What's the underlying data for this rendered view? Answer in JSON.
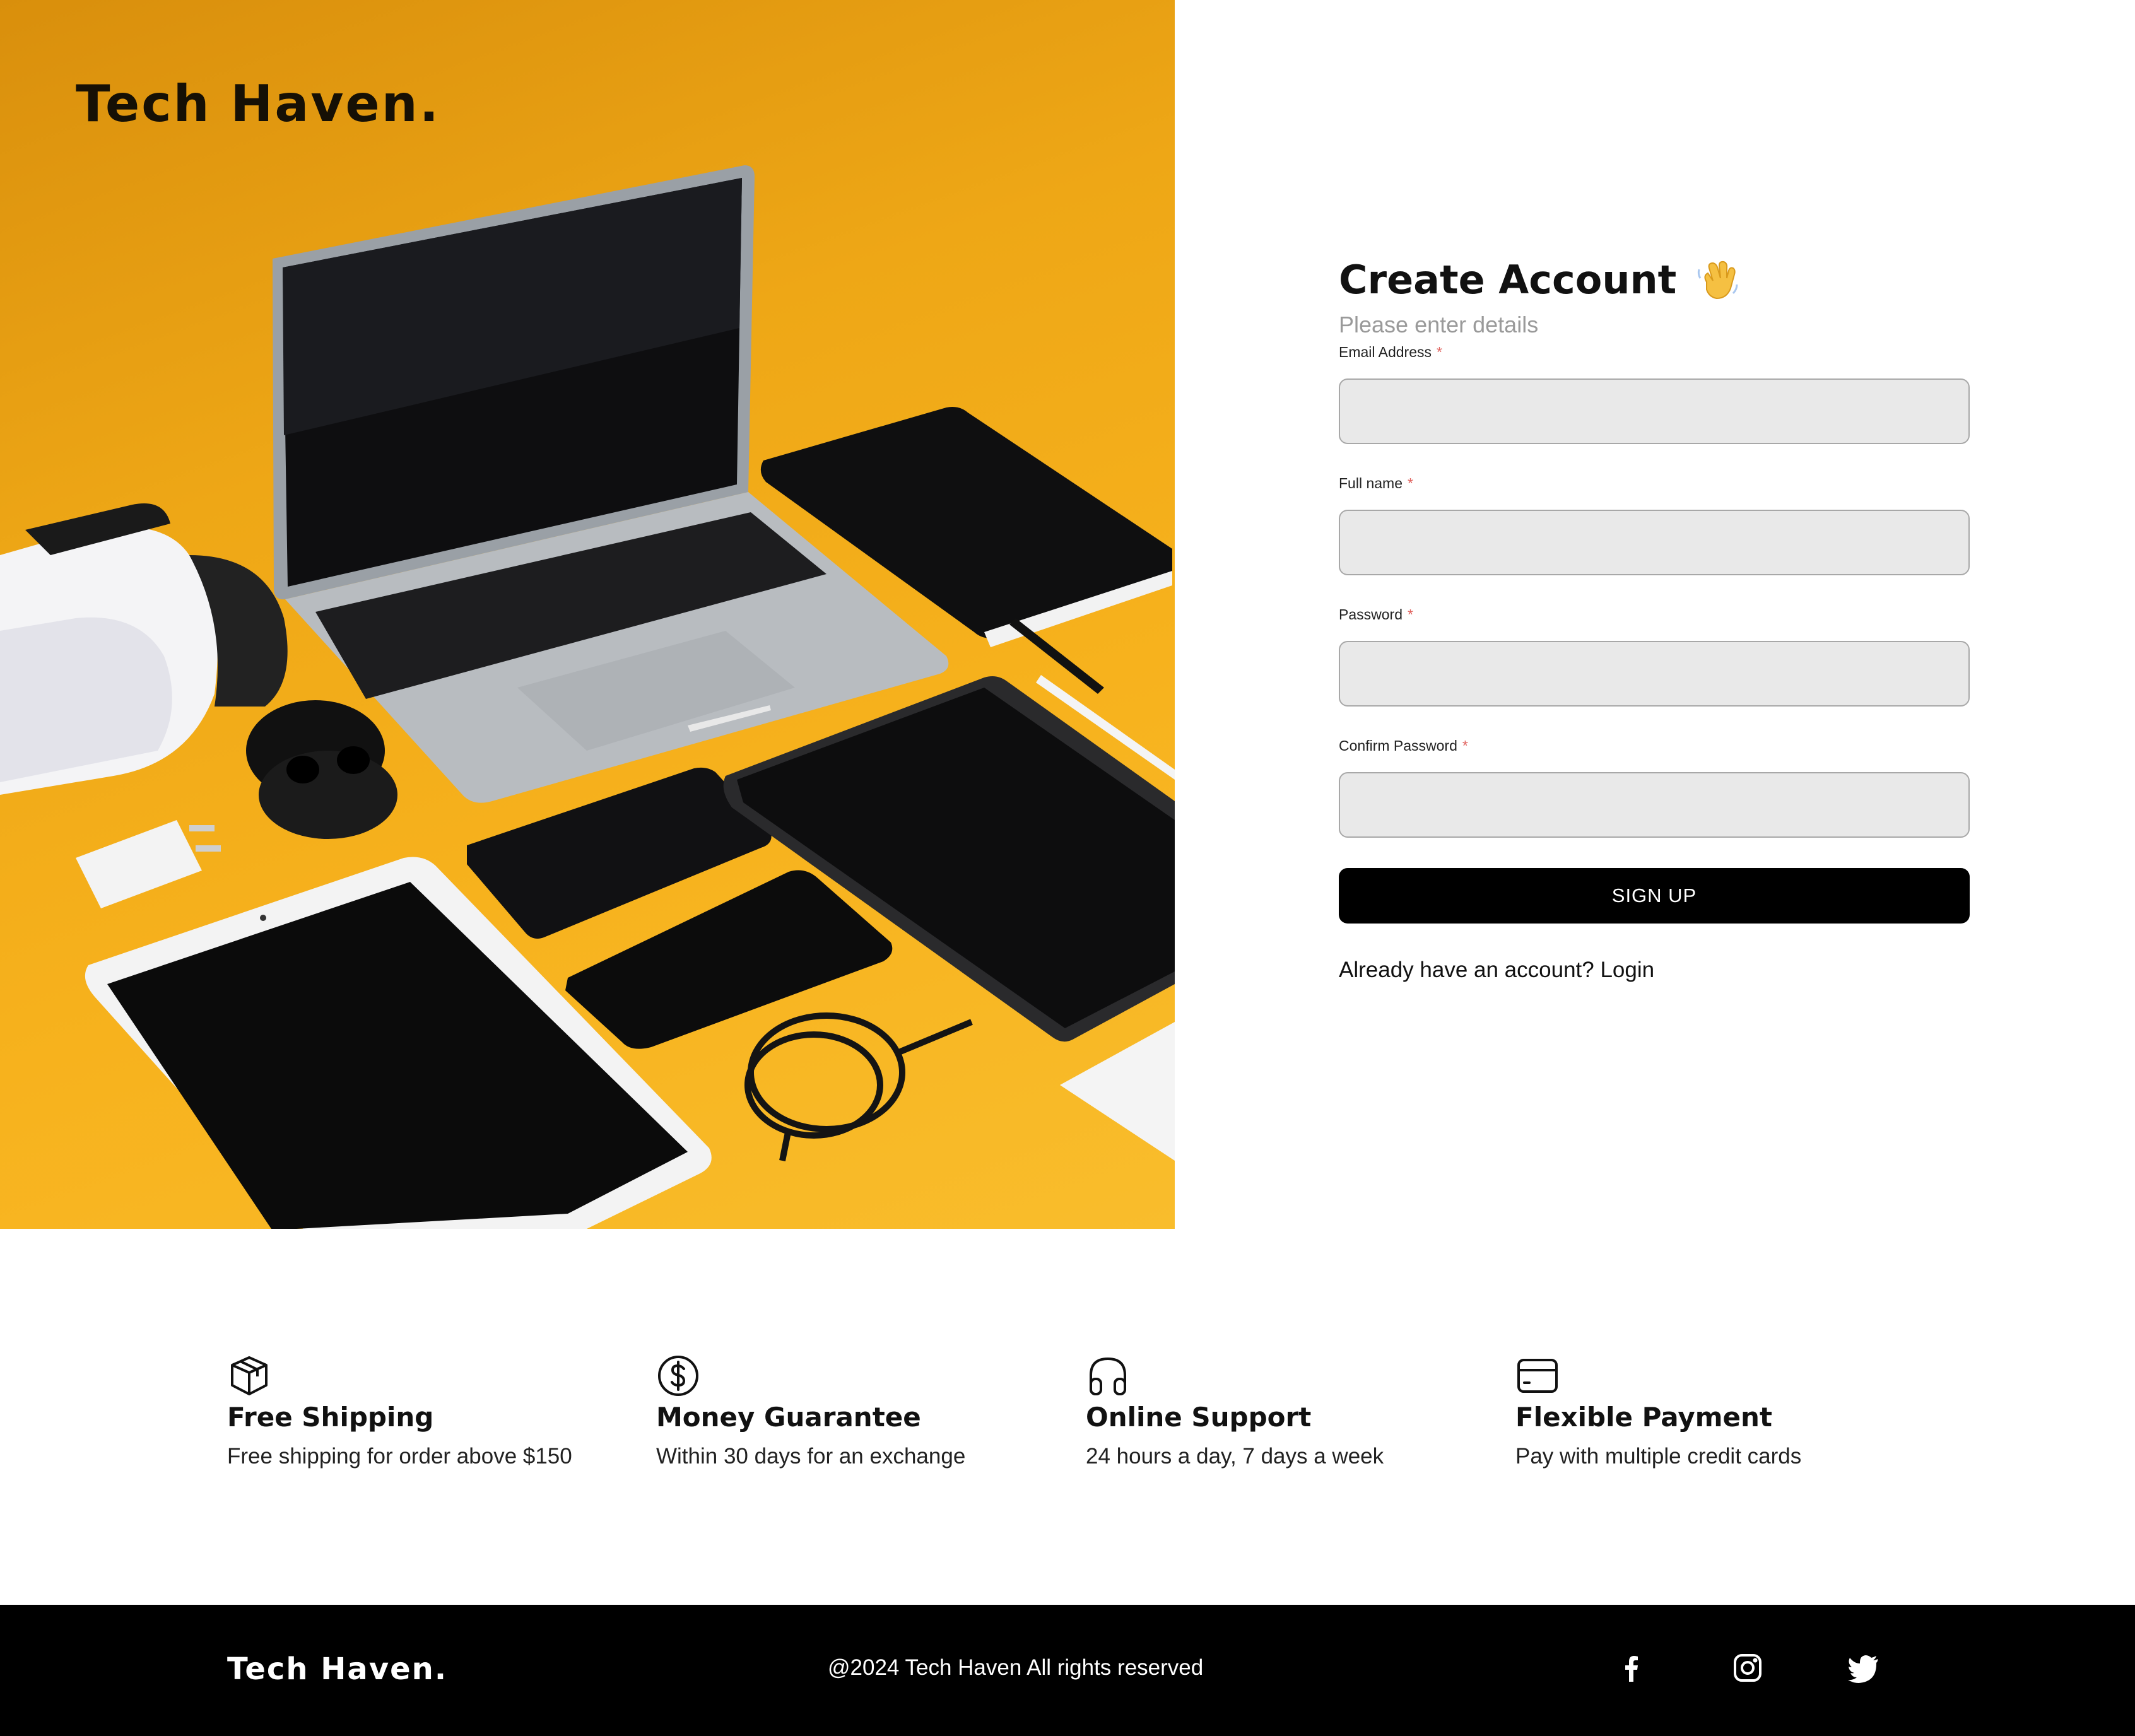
{
  "brand": {
    "name": "Tech Haven."
  },
  "hero": {
    "image_icon": "tech-gadgets-photo"
  },
  "form": {
    "title": "Create Account",
    "title_icon": "waving-hand-icon",
    "subtitle": "Please enter details",
    "fields": [
      {
        "label": "Email Address",
        "required_mark": "*",
        "value": "",
        "type": "email"
      },
      {
        "label": "Full name",
        "required_mark": "*",
        "value": "",
        "type": "text"
      },
      {
        "label": "Password",
        "required_mark": "*",
        "value": "",
        "type": "password"
      },
      {
        "label": "Confirm Password",
        "required_mark": "*",
        "value": "",
        "type": "password"
      }
    ],
    "submit_label": "SIGN UP",
    "login_prompt": "Already have an account?",
    "login_link": "Login"
  },
  "features": [
    {
      "icon": "package-icon",
      "title": "Free Shipping",
      "desc": "Free shipping for order above $150"
    },
    {
      "icon": "dollar-circle-icon",
      "title": "Money Guarantee",
      "desc": "Within 30 days for an exchange"
    },
    {
      "icon": "headphones-icon",
      "title": "Online Support",
      "desc": "24 hours a day, 7 days a week"
    },
    {
      "icon": "credit-card-icon",
      "title": "Flexible Payment",
      "desc": "Pay with multiple credit cards"
    }
  ],
  "footer": {
    "brand": "Tech Haven.",
    "copyright": "@2024 Tech Haven All rights reserved",
    "social": [
      "facebook-icon",
      "instagram-icon",
      "twitter-icon"
    ]
  },
  "colors": {
    "hero_yellow": "#f7b21d",
    "input_bg": "#e9e9e9",
    "required": "#e0605c",
    "button_bg": "#000000",
    "footer_bg": "#000000"
  }
}
